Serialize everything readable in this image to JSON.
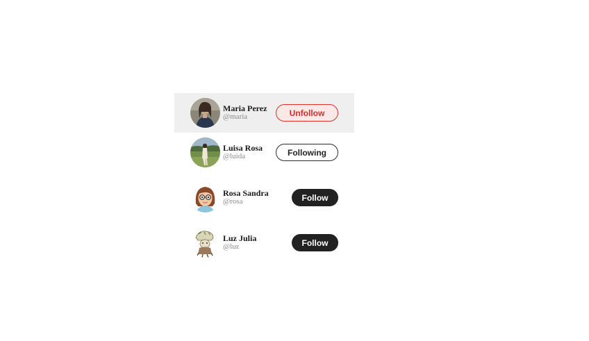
{
  "users": [
    {
      "name": "Maria Perez",
      "handle": "@maria",
      "button_label": "Unfollow",
      "state": "hover-following",
      "avatar_icon": "avatar-photo-woman-indoor"
    },
    {
      "name": "Luisa Rosa",
      "handle": "@luida",
      "button_label": "Following",
      "state": "following",
      "avatar_icon": "avatar-photo-woman-field"
    },
    {
      "name": "Rosa Sandra",
      "handle": "@rosa",
      "button_label": "Follow",
      "state": "not-following",
      "avatar_icon": "avatar-cartoon-girl-glasses"
    },
    {
      "name": "Luz Julia",
      "handle": "@luz",
      "button_label": "Follow",
      "state": "not-following",
      "avatar_icon": "avatar-illustration-figure"
    }
  ],
  "colors": {
    "hover_row_bg": "#efefef",
    "unfollow_red": "#d93030",
    "unfollow_bg": "#fde8e8",
    "follow_dark": "#222222",
    "handle_gray": "#8a8a8a"
  }
}
